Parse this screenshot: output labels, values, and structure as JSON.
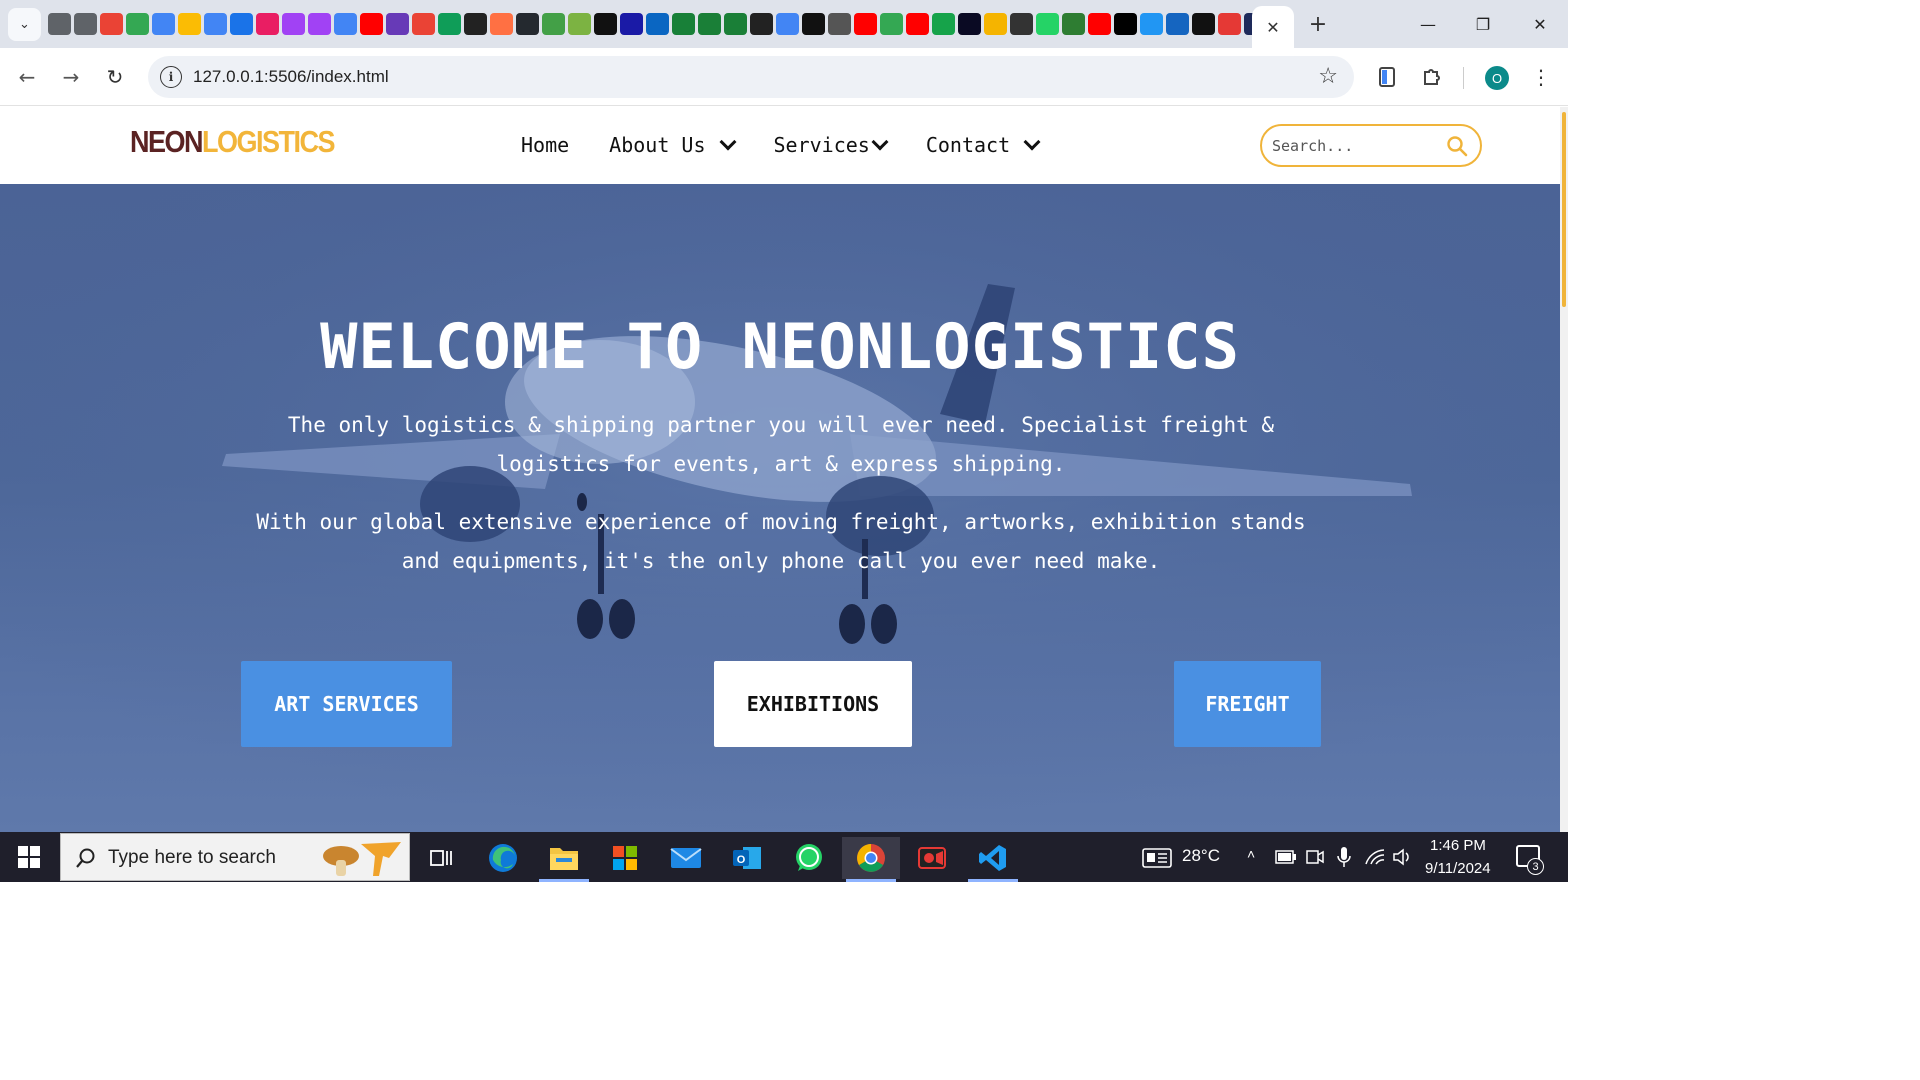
{
  "browser": {
    "url": "127.0.0.1:5506/index.html",
    "active_tab_close": "✕",
    "new_tab": "+",
    "window_controls": {
      "minimize": "—",
      "restore": "❐",
      "close": "✕"
    },
    "profile_initial": "O",
    "bookmark_icons": [
      "globe-icon",
      "globe-icon",
      "gmail-icon",
      "drive-icon",
      "docs-icon",
      "drive-icon",
      "docs-icon",
      "flag-icon",
      "cube-icon",
      "code-icon",
      "code-icon",
      "docs-icon",
      "youtube-icon",
      "forms-icon",
      "gmail-icon",
      "drive-icon",
      "b-icon",
      "sparkle-icon",
      "github-icon",
      "app-icon",
      "pin-icon",
      "triangle-icon",
      "dot-icon",
      "linkedin-icon",
      "sheets-icon",
      "w-icon",
      "w-icon",
      "codepen-icon",
      "app-icon",
      "openai-icon",
      "openai-icon",
      "youtube-icon",
      "drive-icon",
      "youtube-icon",
      "plus-icon",
      "fcc-icon",
      "hat-icon",
      "user-icon",
      "whatsapp-icon",
      "app-icon",
      "youtube-icon",
      "x-icon",
      "app-icon",
      "f-icon",
      "app-icon",
      "search-icon",
      "app-icon",
      "app-icon"
    ],
    "bookmark_colors": [
      "#5f6368",
      "#5f6368",
      "#ea4335",
      "#34a853",
      "#4285f4",
      "#fbbc04",
      "#4285f4",
      "#1a73e8",
      "#e91e63",
      "#a142f4",
      "#a142f4",
      "#4285f4",
      "#ff0000",
      "#673ab7",
      "#ea4335",
      "#0f9d58",
      "#222222",
      "#ff7043",
      "#24292f",
      "#43a047",
      "#7cb342",
      "#111111",
      "#1a1aa6",
      "#0a66c2",
      "#188038",
      "#1a7f37",
      "#1a7f37",
      "#222222",
      "#4285f4",
      "#111111",
      "#555555",
      "#ff0000",
      "#34a853",
      "#ff0000",
      "#16a34a",
      "#0a0a23",
      "#f5b400",
      "#333333",
      "#25d366",
      "#2e7d32",
      "#ff0000",
      "#000000",
      "#2196f3",
      "#1565c0",
      "#111111",
      "#e53935",
      "#1e2a5a",
      "#1e2a5a"
    ]
  },
  "site": {
    "brand": {
      "part1": "NEON",
      "part2": "LOGISTICS",
      "color1": "#5b2323",
      "color2": "#f2b53a"
    },
    "nav": [
      {
        "label": "Home",
        "has_dropdown": false
      },
      {
        "label": "About Us",
        "has_dropdown": true
      },
      {
        "label": "Services",
        "has_dropdown": true
      },
      {
        "label": "Contact",
        "has_dropdown": true
      }
    ],
    "search": {
      "placeholder": "Search...",
      "value": ""
    }
  },
  "hero": {
    "title": "WELCOME TO NEONLOGISTICS",
    "paragraph1": "The only logistics & shipping partner you will ever need. Specialist freight & logistics for events, art & express shipping.",
    "paragraph2": "With our global extensive experience of moving freight, artworks, exhibition stands and equipments, it's the only phone call you ever need make.",
    "buttons": [
      {
        "label": "ART SERVICES"
      },
      {
        "label": "EXHIBITIONS"
      },
      {
        "label": "FREIGHT"
      }
    ],
    "accent": "#4a90e2"
  },
  "taskbar": {
    "search_placeholder": "Type here to search",
    "apps": [
      "task-view-icon",
      "edge-icon",
      "file-explorer-icon",
      "store-icon",
      "mail-icon",
      "outlook-icon",
      "whatsapp-icon",
      "chrome-icon",
      "recorder-icon",
      "vscode-icon"
    ],
    "weather": "28°C",
    "time": "1:46 PM",
    "date": "9/11/2024",
    "notifications": "3"
  }
}
